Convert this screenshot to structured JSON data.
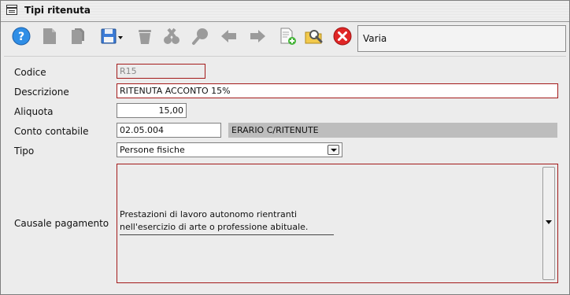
{
  "window": {
    "title": "Tipi ritenuta"
  },
  "toolbar": {
    "buttons": [
      {
        "icon": "help-icon"
      },
      {
        "icon": "new-document-icon"
      },
      {
        "icon": "copy-document-icon"
      },
      {
        "icon": "save-icon"
      },
      {
        "icon": "delete-icon"
      },
      {
        "icon": "cut-icon"
      },
      {
        "icon": "search-icon"
      },
      {
        "icon": "arrow-left-icon"
      },
      {
        "icon": "arrow-right-icon"
      },
      {
        "icon": "add-document-icon"
      },
      {
        "icon": "folder-search-icon"
      },
      {
        "icon": "close-icon"
      }
    ],
    "info_value": "Varia"
  },
  "form": {
    "codice_label": "Codice",
    "codice_value": "R15",
    "descrizione_label": "Descrizione",
    "descrizione_value": "RITENUTA ACCONTO 15%",
    "aliquota_label": "Aliquota",
    "aliquota_value": "15,00",
    "conto_label": "Conto contabile",
    "conto_value": "02.05.004",
    "conto_desc": "ERARIO C/RITENUTE",
    "tipo_label": "Tipo",
    "tipo_value": "Persone fisiche",
    "causale_label": "Causale pagamento",
    "causale_value": "Prestazioni di lavoro autonomo rientranti nell'esercizio di arte o professione abituale."
  },
  "colors": {
    "required_border": "#a31a1a",
    "help_blue": "#2f8ee6",
    "close_red": "#e02626",
    "disabled_grey": "#9b9b9b"
  }
}
